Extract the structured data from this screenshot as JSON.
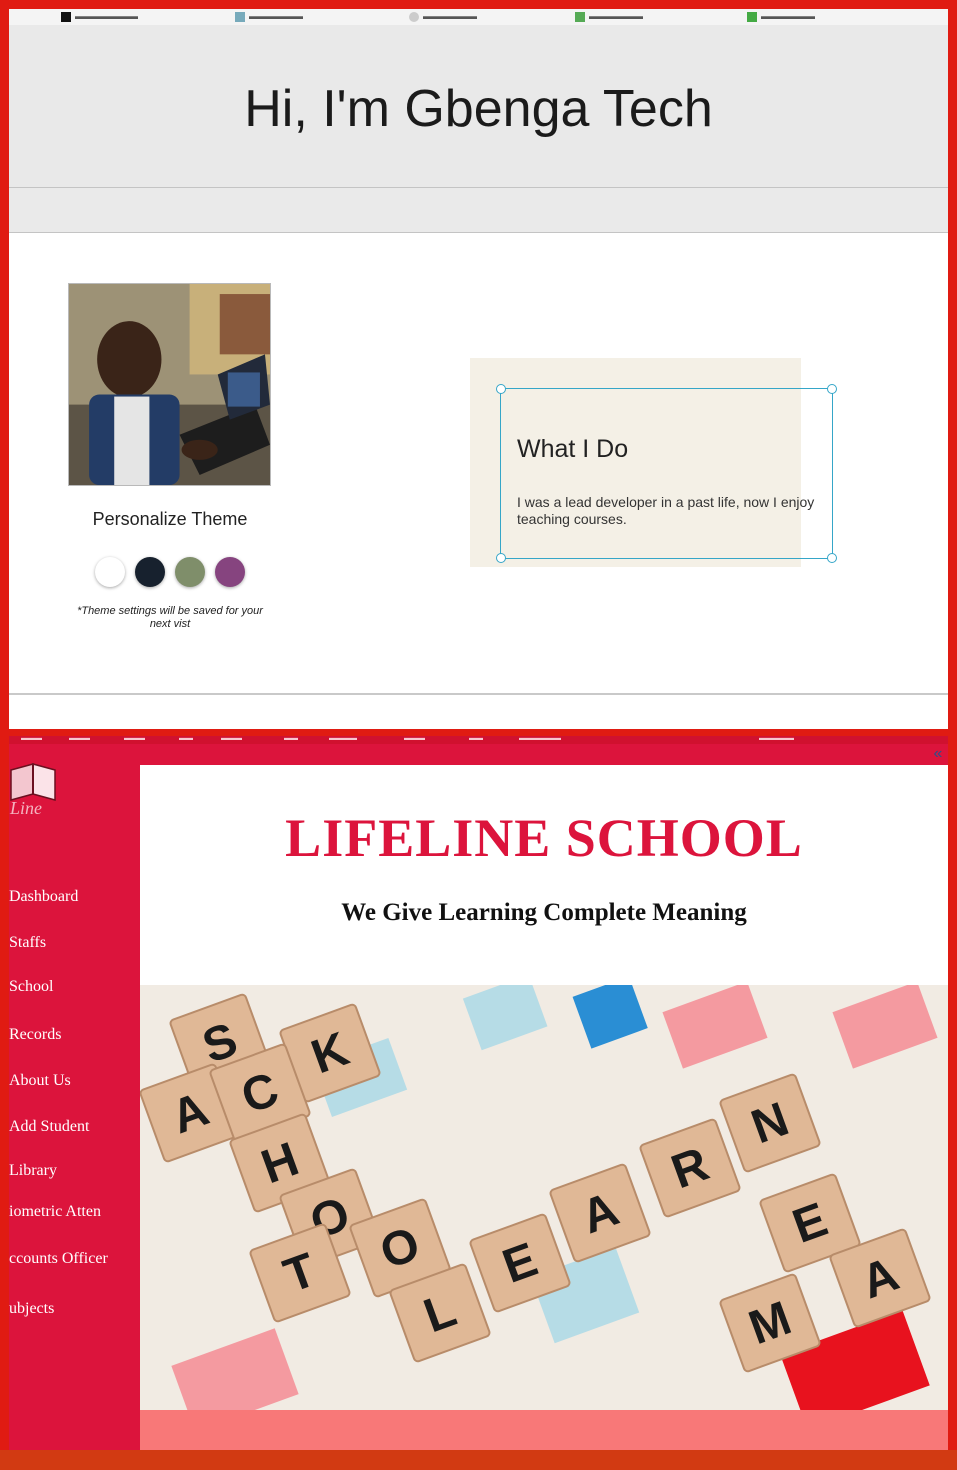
{
  "top": {
    "hero_title": "Hi, I'm Gbenga Tech",
    "profile_photo_alt": "profile photo",
    "theme_title": "Personalize Theme",
    "theme_swatches": [
      {
        "name": "white",
        "color": "#ffffff"
      },
      {
        "name": "navy",
        "color": "#17212e"
      },
      {
        "name": "sage",
        "color": "#7f8e6a"
      },
      {
        "name": "plum",
        "color": "#86447f"
      }
    ],
    "theme_note": "*Theme settings will be saved for your next vist",
    "what_title": "What I Do",
    "what_text": "I was a lead developer in a past life, now I enjoy teaching courses."
  },
  "bottom": {
    "school_name": "LIFELINE SCHOOL",
    "tagline": "We Give Learning Complete Meaning",
    "nav_items": [
      "Dashboard",
      "Staffs",
      "School",
      "Records",
      "About Us",
      "Add Student",
      "Library",
      "iometric Atten",
      "ccounts Officer",
      "ubjects"
    ],
    "banner_tiles": [
      "S",
      "K",
      "A",
      "C",
      "H",
      "O",
      "T",
      "O",
      "L",
      "E",
      "A",
      "R",
      "N",
      "E",
      "M",
      "A"
    ],
    "colors": {
      "brand": "#dc143c",
      "footer": "#f87878"
    }
  }
}
